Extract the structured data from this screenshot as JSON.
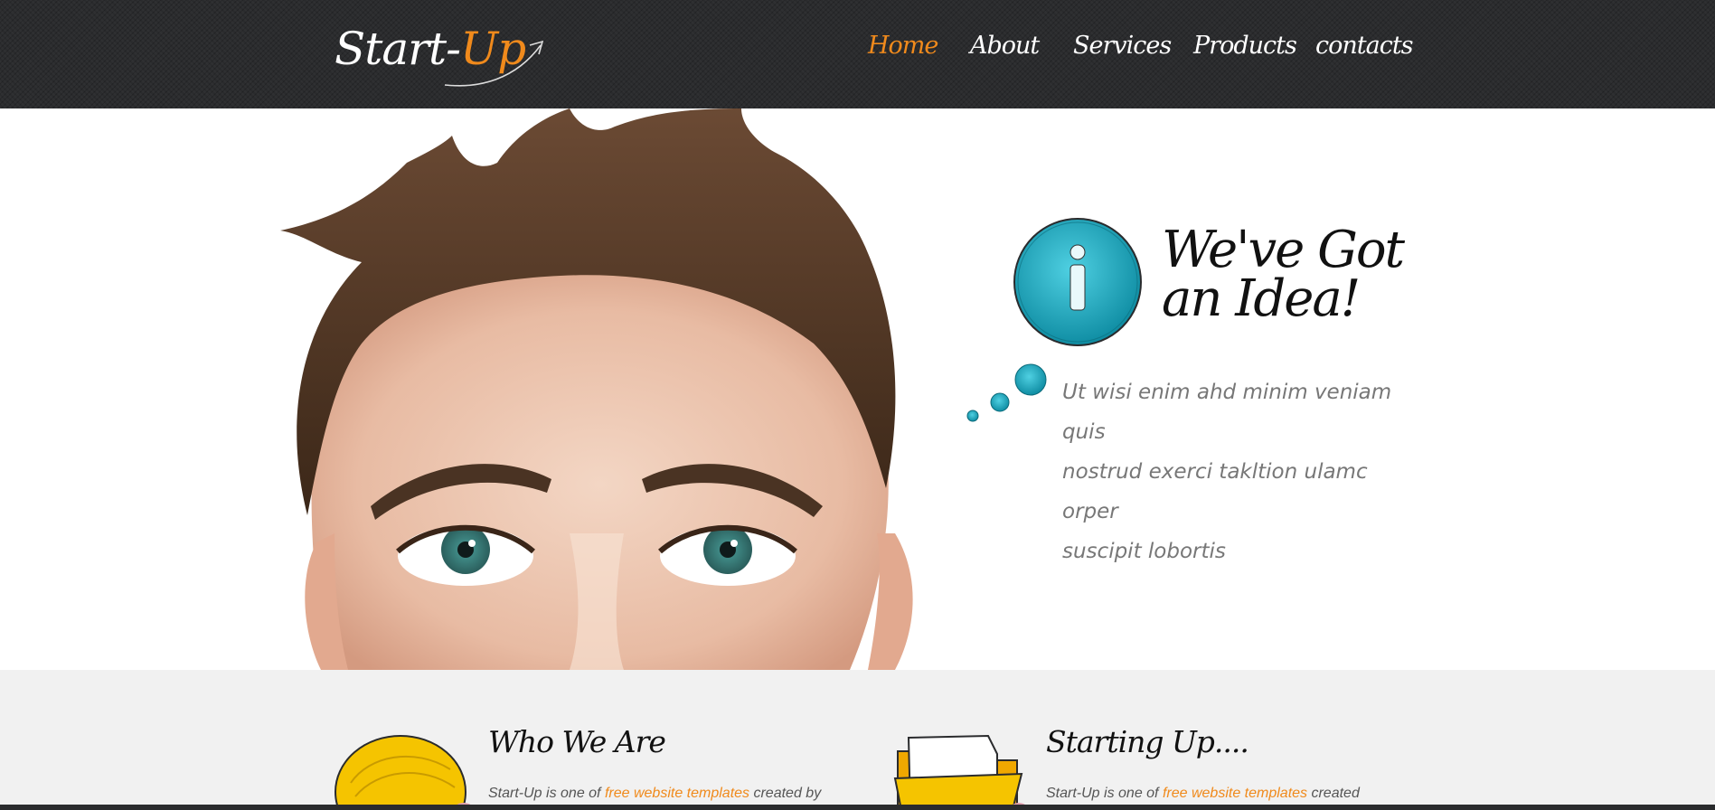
{
  "brand": {
    "logo_text_part1": "Start-",
    "logo_text_part2": "Up",
    "accent_color": "#f08a1c",
    "header_color": "#2a2b2d"
  },
  "nav": {
    "items": [
      {
        "label": "Home",
        "active": true
      },
      {
        "label": "About",
        "active": false
      },
      {
        "label": "Services",
        "active": false
      },
      {
        "label": "Products",
        "active": false
      },
      {
        "label": "contacts",
        "active": false
      }
    ]
  },
  "hero": {
    "title_line1": "We've Got",
    "title_line2": "an Idea!",
    "text_line1": "Ut wisi enim ahd minim veniam quis",
    "text_line2": "nostrud exerci takltion ulamc orper",
    "text_line3": "suscipit lobortis",
    "bubble_icon": "info-icon",
    "bubble_color": "#1aa6bd"
  },
  "features": [
    {
      "title": "Who We Are",
      "text_before": "Start-Up is one of ",
      "link": "free website templates",
      "text_after": " created by",
      "icon": "lightbulb-icon"
    },
    {
      "title": "Starting Up....",
      "text_before": "Start-Up is one of ",
      "link": "free website templates",
      "text_after": " created",
      "icon": "folder-icon"
    }
  ]
}
